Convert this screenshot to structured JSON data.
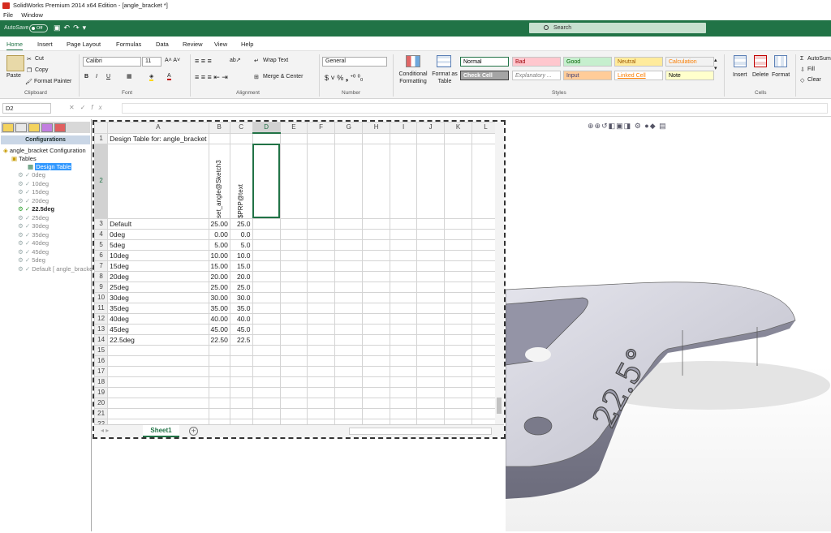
{
  "window": {
    "title": "SolidWorks Premium 2014 x64 Edition - [angle_bracket *]"
  },
  "menubar": [
    "File",
    "Window"
  ],
  "excel": {
    "autosave_label": "AutoSave",
    "autosave_state": "Off",
    "search_placeholder": "Search",
    "tabs": [
      "Home",
      "Insert",
      "Page Layout",
      "Formulas",
      "Data",
      "Review",
      "View",
      "Help"
    ],
    "ribbon": {
      "clipboard": {
        "paste": "Paste",
        "cut": "Cut",
        "copy": "Copy",
        "format_painter": "Format Painter",
        "label": "Clipboard"
      },
      "font": {
        "family": "Calibri",
        "size": "11",
        "label": "Font"
      },
      "alignment": {
        "wrap_text": "Wrap Text",
        "merge_center": "Merge & Center",
        "label": "Alignment"
      },
      "number": {
        "format": "General",
        "label": "Number"
      },
      "styles": {
        "conditional": "Conditional Formatting",
        "format_as_table": "Format as Table",
        "cells": [
          {
            "name": "Normal",
            "bg": "#ffffff",
            "fg": "#000000"
          },
          {
            "name": "Bad",
            "bg": "#ffc7ce",
            "fg": "#9c0006"
          },
          {
            "name": "Good",
            "bg": "#c6efce",
            "fg": "#006100"
          },
          {
            "name": "Neutral",
            "bg": "#ffeb9c",
            "fg": "#9c5700"
          },
          {
            "name": "Calculation",
            "bg": "#f2f2f2",
            "fg": "#fa7d00"
          },
          {
            "name": "Check Cell",
            "bg": "#a5a5a5",
            "fg": "#ffffff"
          },
          {
            "name": "Explanatory ...",
            "bg": "#ffffff",
            "fg": "#7f7f7f"
          },
          {
            "name": "Input",
            "bg": "#ffcc99",
            "fg": "#3f3f76"
          },
          {
            "name": "Linked Cell",
            "bg": "#ffffff",
            "fg": "#fa7d00"
          },
          {
            "name": "Note",
            "bg": "#ffffcc",
            "fg": "#000000"
          }
        ],
        "label": "Styles"
      },
      "cells": {
        "insert": "Insert",
        "delete": "Delete",
        "format": "Format",
        "label": "Cells"
      },
      "editing": {
        "autosum": "AutoSum",
        "fill": "Fill",
        "clear": "Clear"
      }
    },
    "namebox": "D2",
    "fx": "fx",
    "columns": [
      "A",
      "B",
      "C",
      "D",
      "E",
      "F",
      "G",
      "H",
      "I",
      "J",
      "K",
      "L"
    ],
    "rows": [
      {
        "n": "1",
        "a": "Design Table for: angle_bracket",
        "b": "",
        "c": ""
      },
      {
        "n": "2",
        "a": "",
        "b": "set_angle@Sketch3",
        "c": "$PRP@text"
      },
      {
        "n": "3",
        "a": "Default",
        "b": "25.00",
        "c": "25.0"
      },
      {
        "n": "4",
        "a": "0deg",
        "b": "0.00",
        "c": "0.0"
      },
      {
        "n": "5",
        "a": "5deg",
        "b": "5.00",
        "c": "5.0"
      },
      {
        "n": "6",
        "a": "10deg",
        "b": "10.00",
        "c": "10.0"
      },
      {
        "n": "7",
        "a": "15deg",
        "b": "15.00",
        "c": "15.0"
      },
      {
        "n": "8",
        "a": "20deg",
        "b": "20.00",
        "c": "20.0"
      },
      {
        "n": "9",
        "a": "25deg",
        "b": "25.00",
        "c": "25.0"
      },
      {
        "n": "10",
        "a": "30deg",
        "b": "30.00",
        "c": "30.0"
      },
      {
        "n": "11",
        "a": "35deg",
        "b": "35.00",
        "c": "35.0"
      },
      {
        "n": "12",
        "a": "40deg",
        "b": "40.00",
        "c": "40.0"
      },
      {
        "n": "13",
        "a": "45deg",
        "b": "45.00",
        "c": "45.0"
      },
      {
        "n": "14",
        "a": "22.5deg",
        "b": "22.50",
        "c": "22.5"
      },
      {
        "n": "15",
        "a": "",
        "b": "",
        "c": ""
      },
      {
        "n": "16",
        "a": "",
        "b": "",
        "c": ""
      },
      {
        "n": "17",
        "a": "",
        "b": "",
        "c": ""
      },
      {
        "n": "18",
        "a": "",
        "b": "",
        "c": ""
      },
      {
        "n": "19",
        "a": "",
        "b": "",
        "c": ""
      },
      {
        "n": "20",
        "a": "",
        "b": "",
        "c": ""
      },
      {
        "n": "21",
        "a": "",
        "b": "",
        "c": ""
      },
      {
        "n": "22",
        "a": "",
        "b": "",
        "c": ""
      }
    ],
    "sheet_tab": "Sheet1",
    "accent": "#217346"
  },
  "configmanager": {
    "header": "Configurations",
    "root": "angle_bracket Configuration",
    "tables": "Tables",
    "design_table": "Design Table",
    "configs": [
      "0deg",
      "10deg",
      "15deg",
      "20deg",
      "22.5deg",
      "25deg",
      "30deg",
      "35deg",
      "40deg",
      "45deg",
      "5deg",
      "Default [ angle_bracket ]"
    ],
    "active_config": "22.5deg"
  },
  "model": {
    "engraved_text": "22.5°"
  }
}
